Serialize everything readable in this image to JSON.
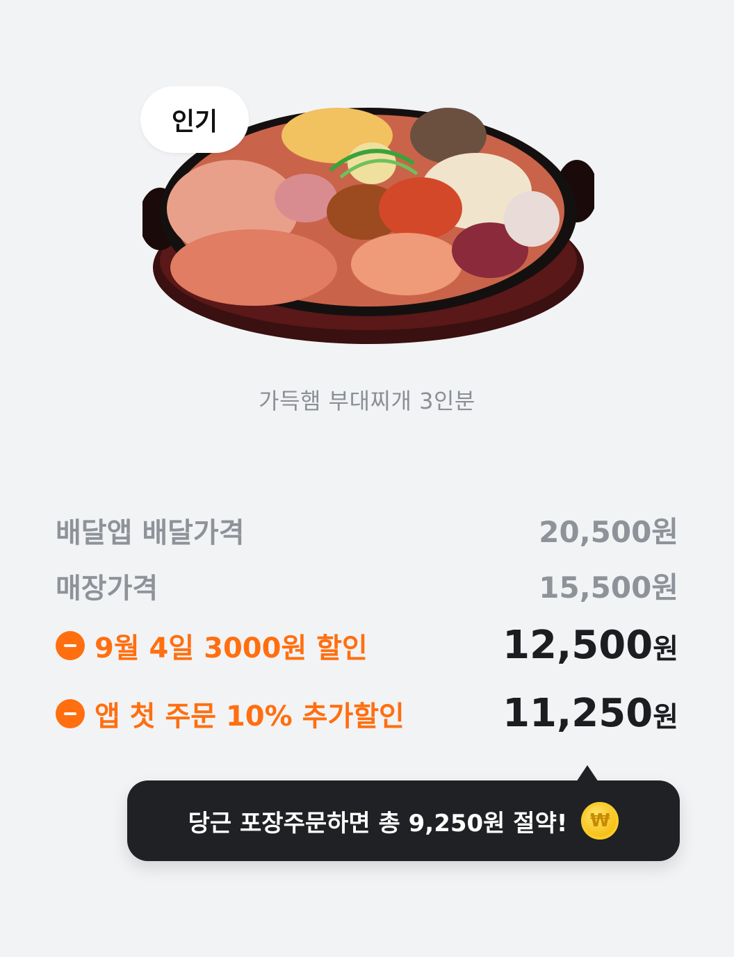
{
  "badge": {
    "label": "인기"
  },
  "product": {
    "name": "가득햄 부대찌개 3인분"
  },
  "prices": {
    "delivery": {
      "label": "배달앱 배달가격",
      "value": "20,500원"
    },
    "store": {
      "label": "매장가격",
      "value": "15,500원"
    },
    "discount1": {
      "label": "9월 4일 3000원 할인",
      "value": "12,500",
      "unit": "원"
    },
    "discount2": {
      "label": "앱 첫 주문 10% 추가할인",
      "value": "11,250",
      "unit": "원"
    }
  },
  "tooltip": {
    "text": "당근 포장주문하면 총 9,250원 절약!",
    "icon": "won-coin-icon"
  },
  "colors": {
    "accent": "#ff6f0f",
    "tooltip_bg": "#1f2124",
    "muted": "#8e939a"
  }
}
